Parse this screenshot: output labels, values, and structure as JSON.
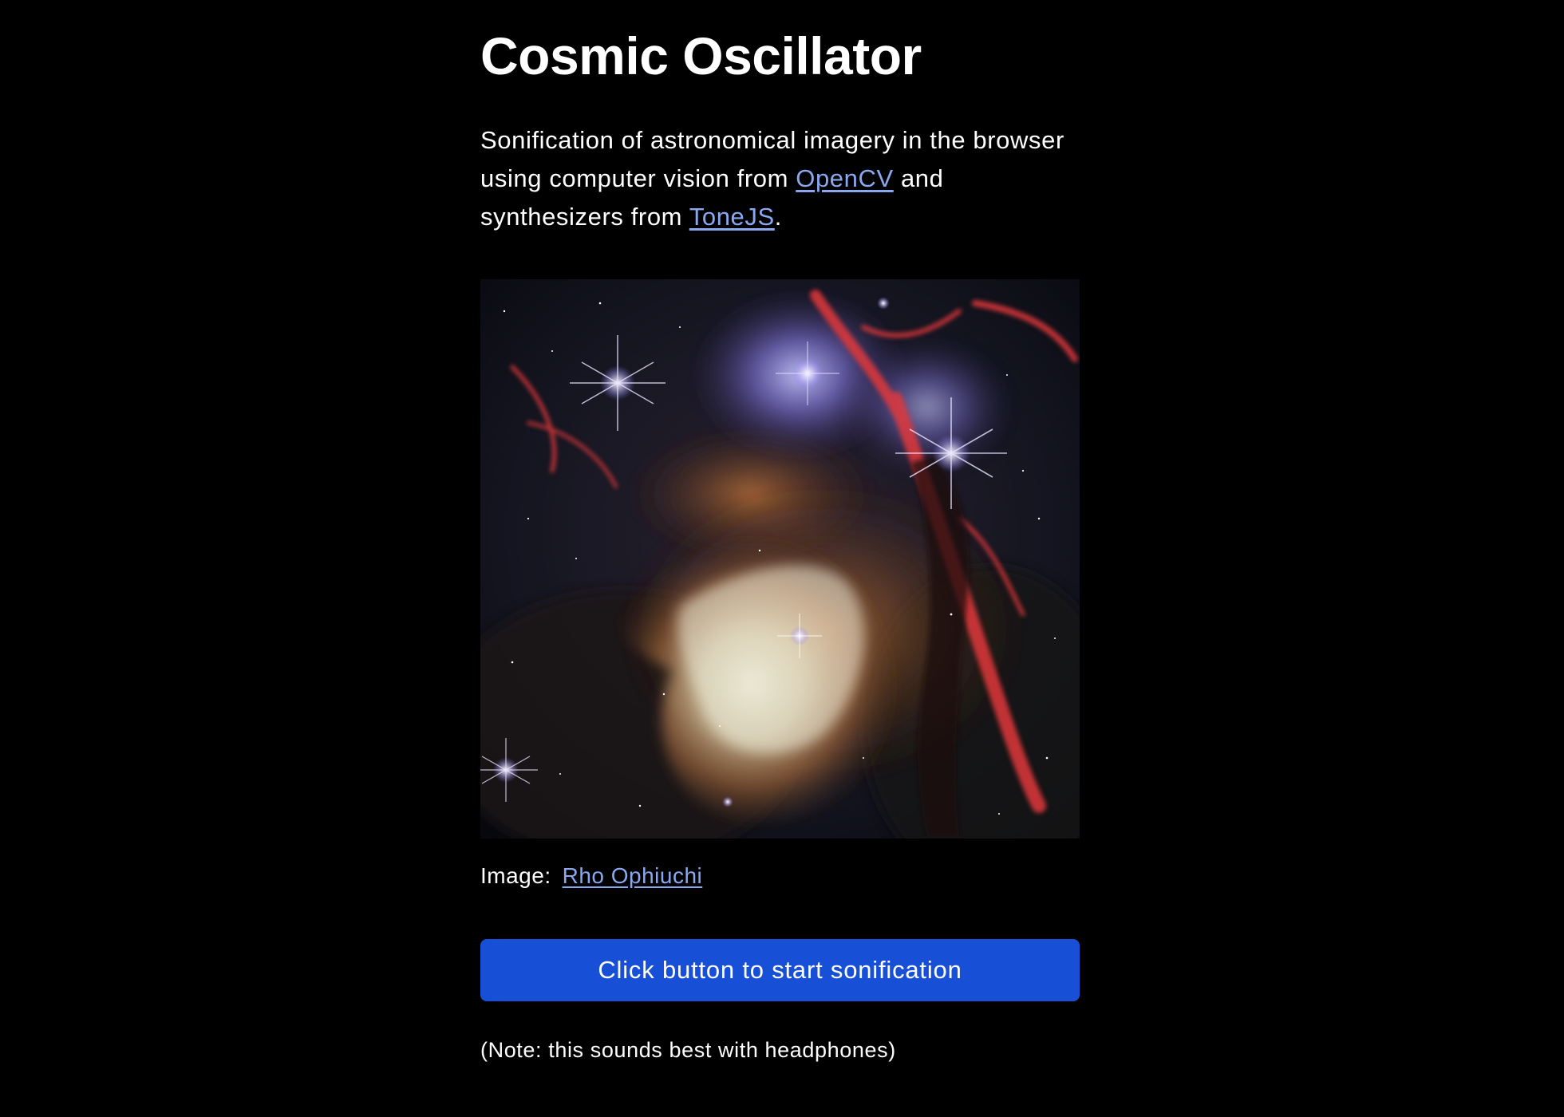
{
  "title": "Cosmic Oscillator",
  "intro": {
    "text_before_opencv": "Sonification of astronomical imagery in the browser using computer vision from ",
    "opencv_link": "OpenCV",
    "text_between": " and synthesizers from ",
    "tonejs_link": "ToneJS",
    "text_after": "."
  },
  "image": {
    "alt": "Rho Ophiuchi"
  },
  "caption": {
    "label": "Image:",
    "link": "Rho Ophiuchi"
  },
  "start_button": {
    "label": "Click button to start sonification"
  },
  "note": "(Note: this sounds best with headphones)",
  "colors": {
    "background": "#000000",
    "text": "#ffffff",
    "link": "#8aa8f0",
    "button": "#1750d6"
  }
}
